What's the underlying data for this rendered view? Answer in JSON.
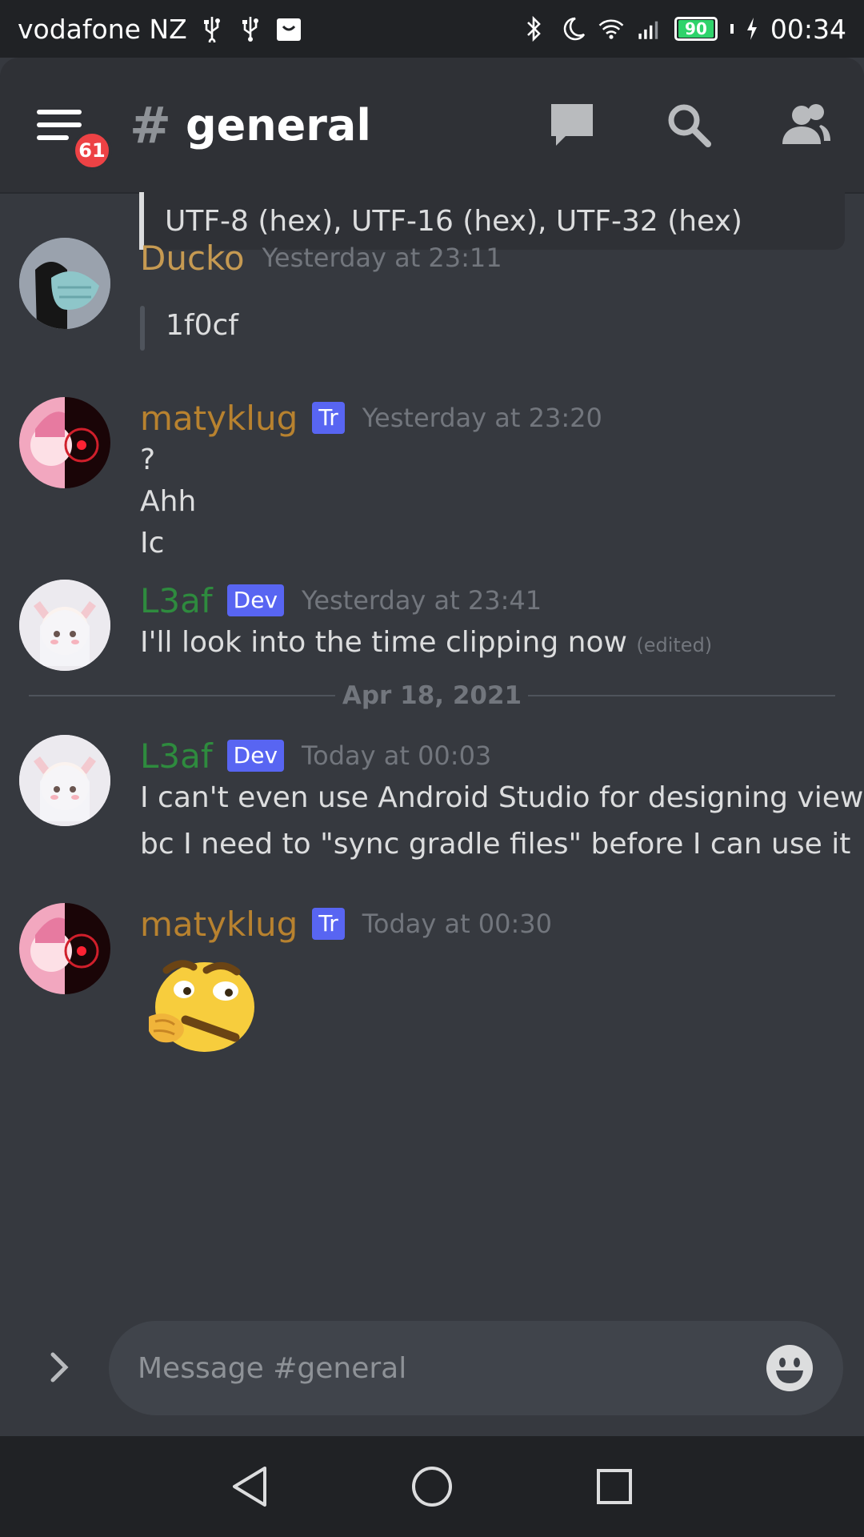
{
  "status_bar": {
    "carrier": "vodafone NZ",
    "battery": "90",
    "time": "00:34",
    "icons": [
      "usb-icon",
      "usb-icon",
      "shopping-bag-icon",
      "bluetooth-icon",
      "moon-icon",
      "wifi-icon",
      "signal-icon",
      "battery-icon",
      "charging-icon"
    ]
  },
  "header": {
    "badge": "61",
    "hash": "#",
    "channel": "general",
    "actions": [
      "threads-icon",
      "search-icon",
      "members-icon"
    ]
  },
  "embed_tail": "UTF-8 (hex), UTF-16 (hex), UTF-32 (hex)",
  "messages": [
    {
      "author": "Ducko",
      "author_color": "#c69a52",
      "timestamp": "Yesterday at 23:11",
      "lines": [
        "1f0cf"
      ]
    },
    {
      "author": "matyklug",
      "author_color": "#b8822f",
      "tag": "Tr",
      "timestamp": "Yesterday at 23:20",
      "lines": [
        "?",
        "Ahh",
        "Ic"
      ]
    },
    {
      "author": "L3af",
      "author_color": "#2e8b3e",
      "tag": "Dev",
      "timestamp": "Yesterday at 23:41",
      "lines": [
        "I'll look into the time clipping now"
      ],
      "edited": "(edited)"
    },
    {
      "author": "L3af",
      "author_color": "#2e8b3e",
      "tag": "Dev",
      "timestamp": "Today at 00:03",
      "lines": [
        "I can't even use Android Studio for designing views",
        "bc I need to \"sync gradle files\" before I can use it"
      ]
    },
    {
      "author": "matyklug",
      "author_color": "#b8822f",
      "tag": "Tr",
      "timestamp": "Today at 00:30",
      "emoji": "thonk-emoji"
    }
  ],
  "date_divider": "Apr 18, 2021",
  "composer": {
    "placeholder": "Message #general"
  },
  "colors": {
    "background": "#36393f",
    "header": "#2f3136",
    "statusbar": "#202225",
    "mention_badge": "#ed4245",
    "role_tag": "#5865f2"
  }
}
